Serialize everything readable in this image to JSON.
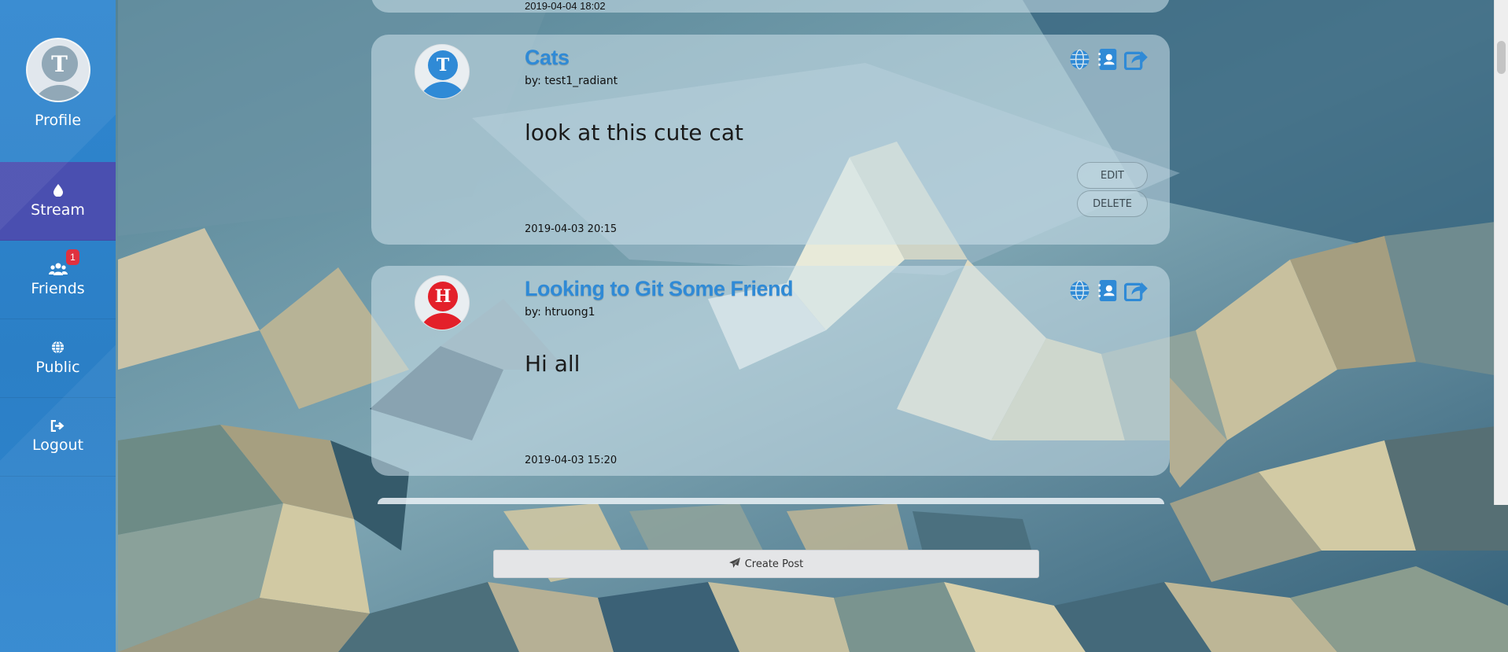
{
  "sidebar": {
    "profile": {
      "label": "Profile",
      "avatar_letter": "T"
    },
    "items": [
      {
        "label": "Stream",
        "icon": "drop-icon",
        "active": true
      },
      {
        "label": "Friends",
        "icon": "users-icon",
        "badge": "1"
      },
      {
        "label": "Public",
        "icon": "globe-icon"
      },
      {
        "label": "Logout",
        "icon": "sign-out-icon"
      }
    ]
  },
  "stream": {
    "partial_top_post": {
      "date": "2019-04-04 18:02"
    },
    "posts": [
      {
        "title": "Cats",
        "author": "by: test1_radiant",
        "avatar_letter": "T",
        "avatar_color": "#2f8ad6",
        "content": "look at this cute cat",
        "date": "2019-04-03 20:15",
        "edit_label": "EDIT",
        "delete_label": "DELETE",
        "icons": [
          "globe-icon",
          "contact-card-icon",
          "share-icon"
        ]
      },
      {
        "title": "Looking to Git Some Friend",
        "author": "by: htruong1",
        "avatar_letter": "H",
        "avatar_color": "#e3202a",
        "content": "Hi all",
        "date": "2019-04-03 15:20",
        "icons": [
          "globe-icon",
          "contact-card-icon",
          "share-icon"
        ]
      }
    ]
  },
  "create_post": {
    "label": "Create Post",
    "icon": "paper-plane-icon"
  },
  "colors": {
    "sidebar": "#2f86cf",
    "active_nav": "#4a4fb0",
    "title": "#2f8ad6",
    "badge": "#e0313f"
  }
}
